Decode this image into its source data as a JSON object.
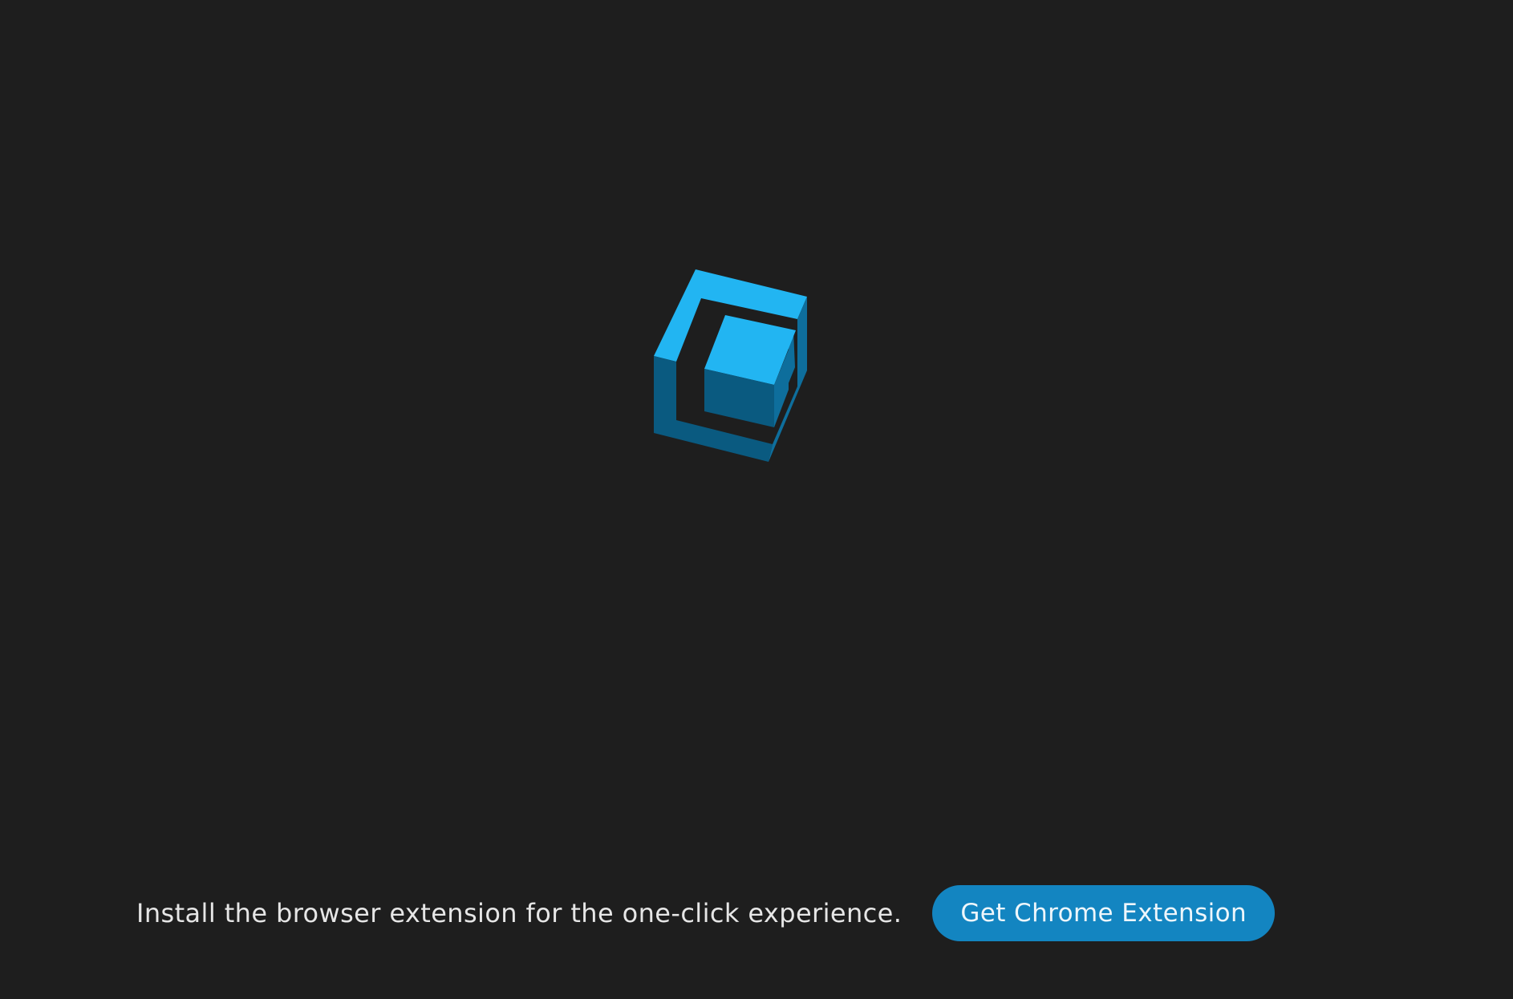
{
  "logo": {
    "icon": "cube-logo-icon",
    "colors": {
      "face_light": "#22b5f2",
      "face_dark": "#0a5a80",
      "face_mid": "#0e6e9c",
      "background": "#1e1e1e"
    }
  },
  "footer": {
    "install_text": "Install the browser extension for the one-click experience.",
    "button_label": "Get Chrome Extension",
    "button_color": "#1385c1"
  }
}
